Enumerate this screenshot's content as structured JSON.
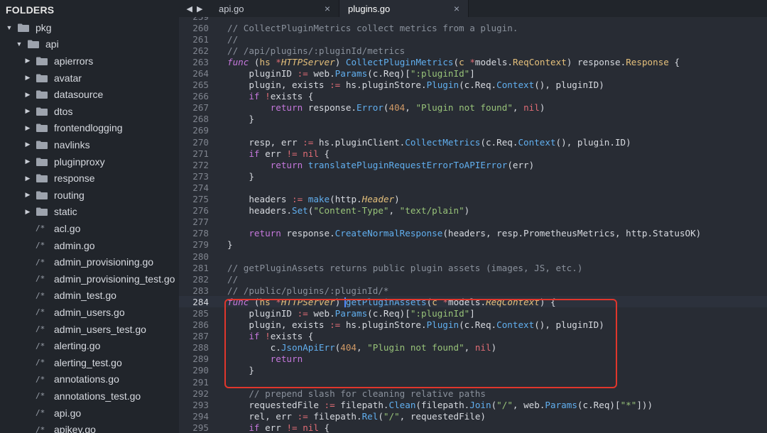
{
  "sidebar": {
    "header": "FOLDERS",
    "tree": [
      {
        "label": "pkg",
        "kind": "folder",
        "open": true,
        "depth": 0
      },
      {
        "label": "api",
        "kind": "folder",
        "open": true,
        "depth": 1
      },
      {
        "label": "apierrors",
        "kind": "folder",
        "open": false,
        "depth": 2
      },
      {
        "label": "avatar",
        "kind": "folder",
        "open": false,
        "depth": 2
      },
      {
        "label": "datasource",
        "kind": "folder",
        "open": false,
        "depth": 2
      },
      {
        "label": "dtos",
        "kind": "folder",
        "open": false,
        "depth": 2
      },
      {
        "label": "frontendlogging",
        "kind": "folder",
        "open": false,
        "depth": 2
      },
      {
        "label": "navlinks",
        "kind": "folder",
        "open": false,
        "depth": 2
      },
      {
        "label": "pluginproxy",
        "kind": "folder",
        "open": false,
        "depth": 2
      },
      {
        "label": "response",
        "kind": "folder",
        "open": false,
        "depth": 2
      },
      {
        "label": "routing",
        "kind": "folder",
        "open": false,
        "depth": 2
      },
      {
        "label": "static",
        "kind": "folder",
        "open": false,
        "depth": 2
      },
      {
        "label": "acl.go",
        "kind": "file",
        "depth": 2
      },
      {
        "label": "admin.go",
        "kind": "file",
        "depth": 2
      },
      {
        "label": "admin_provisioning.go",
        "kind": "file",
        "depth": 2
      },
      {
        "label": "admin_provisioning_test.go",
        "kind": "file",
        "depth": 2
      },
      {
        "label": "admin_test.go",
        "kind": "file",
        "depth": 2
      },
      {
        "label": "admin_users.go",
        "kind": "file",
        "depth": 2
      },
      {
        "label": "admin_users_test.go",
        "kind": "file",
        "depth": 2
      },
      {
        "label": "alerting.go",
        "kind": "file",
        "depth": 2
      },
      {
        "label": "alerting_test.go",
        "kind": "file",
        "depth": 2
      },
      {
        "label": "annotations.go",
        "kind": "file",
        "depth": 2
      },
      {
        "label": "annotations_test.go",
        "kind": "file",
        "depth": 2
      },
      {
        "label": "api.go",
        "kind": "file",
        "depth": 2
      },
      {
        "label": "apikey.go",
        "kind": "file",
        "depth": 2
      }
    ],
    "file_glyph": "/*"
  },
  "tabs": [
    {
      "label": "api.go",
      "active": false,
      "close": "×"
    },
    {
      "label": "plugins.go",
      "active": true,
      "close": "×"
    }
  ],
  "icons": {
    "back": "arrow-left-icon",
    "forward": "arrow-right-icon",
    "folder": "folder-icon",
    "file": "file-icon"
  },
  "colors": {
    "highlight_box": "#e0362c",
    "keyword": "#c678dd",
    "function": "#61afef",
    "type": "#e5c07b",
    "string": "#98c379",
    "number": "#d19a66",
    "comment": "#8a919c"
  },
  "editor": {
    "current_line": 284,
    "lines": [
      {
        "n": "259",
        "tokens": []
      },
      {
        "n": "260",
        "tokens": [
          [
            "cm",
            "// CollectPluginMetrics collect metrics from a plugin."
          ]
        ]
      },
      {
        "n": "261",
        "tokens": [
          [
            "cm",
            "//"
          ]
        ]
      },
      {
        "n": "262",
        "tokens": [
          [
            "cm",
            "// /api/plugins/:pluginId/metrics"
          ]
        ]
      },
      {
        "n": "263",
        "tokens": [
          [
            "kwi",
            "func"
          ],
          [
            "pl",
            " ("
          ],
          [
            "ty",
            "hs"
          ],
          [
            "pl",
            " "
          ],
          [
            "op",
            "*"
          ],
          [
            "tyi",
            "HTTPServer"
          ],
          [
            "pl",
            ") "
          ],
          [
            "fn",
            "CollectPluginMetrics"
          ],
          [
            "pl",
            "("
          ],
          [
            "ty",
            "c"
          ],
          [
            "pl",
            " "
          ],
          [
            "op",
            "*"
          ],
          [
            "pl",
            "models."
          ],
          [
            "ty",
            "ReqContext"
          ],
          [
            "pl",
            ") response."
          ],
          [
            "ty",
            "Response"
          ],
          [
            "pl",
            " {"
          ]
        ]
      },
      {
        "n": "264",
        "tokens": [
          [
            "pl",
            "    pluginID "
          ],
          [
            "op",
            ":="
          ],
          [
            "pl",
            " web."
          ],
          [
            "fn",
            "Params"
          ],
          [
            "pl",
            "(c.Req)["
          ],
          [
            "st",
            "\":pluginId\""
          ],
          [
            "pl",
            "]"
          ]
        ]
      },
      {
        "n": "265",
        "tokens": [
          [
            "pl",
            "    plugin, exists "
          ],
          [
            "op",
            ":="
          ],
          [
            "pl",
            " hs.pluginStore."
          ],
          [
            "fn",
            "Plugin"
          ],
          [
            "pl",
            "(c.Req."
          ],
          [
            "fn",
            "Context"
          ],
          [
            "pl",
            "(), pluginID)"
          ]
        ]
      },
      {
        "n": "266",
        "tokens": [
          [
            "pl",
            "    "
          ],
          [
            "kw",
            "if"
          ],
          [
            "pl",
            " "
          ],
          [
            "op",
            "!"
          ],
          [
            "pl",
            "exists {"
          ]
        ]
      },
      {
        "n": "267",
        "tokens": [
          [
            "pl",
            "        "
          ],
          [
            "kw",
            "return"
          ],
          [
            "pl",
            " response."
          ],
          [
            "fn",
            "Error"
          ],
          [
            "pl",
            "("
          ],
          [
            "nu",
            "404"
          ],
          [
            "pl",
            ", "
          ],
          [
            "st",
            "\"Plugin not found\""
          ],
          [
            "pl",
            ", "
          ],
          [
            "op",
            "nil"
          ],
          [
            "pl",
            ")"
          ]
        ]
      },
      {
        "n": "268",
        "tokens": [
          [
            "pl",
            "    }"
          ]
        ]
      },
      {
        "n": "269",
        "tokens": []
      },
      {
        "n": "270",
        "tokens": [
          [
            "pl",
            "    resp, err "
          ],
          [
            "op",
            ":="
          ],
          [
            "pl",
            " hs.pluginClient."
          ],
          [
            "fn",
            "CollectMetrics"
          ],
          [
            "pl",
            "(c.Req."
          ],
          [
            "fn",
            "Context"
          ],
          [
            "pl",
            "(), plugin.ID)"
          ]
        ]
      },
      {
        "n": "271",
        "tokens": [
          [
            "pl",
            "    "
          ],
          [
            "kw",
            "if"
          ],
          [
            "pl",
            " err "
          ],
          [
            "op",
            "!="
          ],
          [
            "pl",
            " "
          ],
          [
            "op",
            "nil"
          ],
          [
            "pl",
            " {"
          ]
        ]
      },
      {
        "n": "272",
        "tokens": [
          [
            "pl",
            "        "
          ],
          [
            "kw",
            "return"
          ],
          [
            "pl",
            " "
          ],
          [
            "fn",
            "translatePluginRequestErrorToAPIError"
          ],
          [
            "pl",
            "(err)"
          ]
        ]
      },
      {
        "n": "273",
        "tokens": [
          [
            "pl",
            "    }"
          ]
        ]
      },
      {
        "n": "274",
        "tokens": []
      },
      {
        "n": "275",
        "tokens": [
          [
            "pl",
            "    headers "
          ],
          [
            "op",
            ":="
          ],
          [
            "pl",
            " "
          ],
          [
            "fn",
            "make"
          ],
          [
            "pl",
            "(http."
          ],
          [
            "tyi",
            "Header"
          ],
          [
            "pl",
            ")"
          ]
        ]
      },
      {
        "n": "276",
        "tokens": [
          [
            "pl",
            "    headers."
          ],
          [
            "fn",
            "Set"
          ],
          [
            "pl",
            "("
          ],
          [
            "st",
            "\"Content-Type\""
          ],
          [
            "pl",
            ", "
          ],
          [
            "st",
            "\"text/plain\""
          ],
          [
            "pl",
            ")"
          ]
        ]
      },
      {
        "n": "277",
        "tokens": []
      },
      {
        "n": "278",
        "tokens": [
          [
            "pl",
            "    "
          ],
          [
            "kw",
            "return"
          ],
          [
            "pl",
            " response."
          ],
          [
            "fn",
            "CreateNormalResponse"
          ],
          [
            "pl",
            "(headers, resp.PrometheusMetrics, http.StatusOK)"
          ]
        ]
      },
      {
        "n": "279",
        "tokens": [
          [
            "pl",
            "}"
          ]
        ]
      },
      {
        "n": "280",
        "tokens": []
      },
      {
        "n": "281",
        "tokens": [
          [
            "cm",
            "// getPluginAssets returns public plugin assets (images, JS, etc.)"
          ]
        ]
      },
      {
        "n": "282",
        "tokens": [
          [
            "cm",
            "//"
          ]
        ]
      },
      {
        "n": "283",
        "tokens": [
          [
            "cm",
            "// /public/plugins/:pluginId/*"
          ]
        ]
      },
      {
        "n": "284",
        "tokens": [
          [
            "kwi",
            "func"
          ],
          [
            "pl",
            " ("
          ],
          [
            "ty",
            "hs"
          ],
          [
            "pl",
            " "
          ],
          [
            "op",
            "*"
          ],
          [
            "tyi",
            "HTTPServer"
          ],
          [
            "pl",
            ") "
          ],
          [
            "fn",
            "getPluginAssets"
          ],
          [
            "pl",
            "("
          ],
          [
            "ty",
            "c"
          ],
          [
            "pl",
            " "
          ],
          [
            "op",
            "*"
          ],
          [
            "pl",
            "models."
          ],
          [
            "tyi",
            "ReqContext"
          ],
          [
            "pl",
            ") {"
          ]
        ]
      },
      {
        "n": "285",
        "tokens": [
          [
            "pl",
            "    pluginID "
          ],
          [
            "op",
            ":="
          ],
          [
            "pl",
            " web."
          ],
          [
            "fn",
            "Params"
          ],
          [
            "pl",
            "(c.Req)["
          ],
          [
            "st",
            "\":pluginId\""
          ],
          [
            "pl",
            "]"
          ]
        ]
      },
      {
        "n": "286",
        "tokens": [
          [
            "pl",
            "    plugin, exists "
          ],
          [
            "op",
            ":="
          ],
          [
            "pl",
            " hs.pluginStore."
          ],
          [
            "fn",
            "Plugin"
          ],
          [
            "pl",
            "(c.Req."
          ],
          [
            "fn",
            "Context"
          ],
          [
            "pl",
            "(), pluginID)"
          ]
        ]
      },
      {
        "n": "287",
        "tokens": [
          [
            "pl",
            "    "
          ],
          [
            "kw",
            "if"
          ],
          [
            "pl",
            " "
          ],
          [
            "op",
            "!"
          ],
          [
            "pl",
            "exists {"
          ]
        ]
      },
      {
        "n": "288",
        "tokens": [
          [
            "pl",
            "        c."
          ],
          [
            "fn",
            "JsonApiErr"
          ],
          [
            "pl",
            "("
          ],
          [
            "nu",
            "404"
          ],
          [
            "pl",
            ", "
          ],
          [
            "st",
            "\"Plugin not found\""
          ],
          [
            "pl",
            ", "
          ],
          [
            "op",
            "nil"
          ],
          [
            "pl",
            ")"
          ]
        ]
      },
      {
        "n": "289",
        "tokens": [
          [
            "pl",
            "        "
          ],
          [
            "kw",
            "return"
          ]
        ]
      },
      {
        "n": "290",
        "tokens": [
          [
            "pl",
            "    }"
          ]
        ]
      },
      {
        "n": "291",
        "tokens": []
      },
      {
        "n": "292",
        "tokens": [
          [
            "pl",
            "    "
          ],
          [
            "cm",
            "// prepend slash for cleaning relative paths"
          ]
        ]
      },
      {
        "n": "293",
        "tokens": [
          [
            "pl",
            "    requestedFile "
          ],
          [
            "op",
            ":="
          ],
          [
            "pl",
            " filepath."
          ],
          [
            "fn",
            "Clean"
          ],
          [
            "pl",
            "(filepath."
          ],
          [
            "fn",
            "Join"
          ],
          [
            "pl",
            "("
          ],
          [
            "st",
            "\"/\""
          ],
          [
            "pl",
            ", web."
          ],
          [
            "fn",
            "Params"
          ],
          [
            "pl",
            "(c.Req)["
          ],
          [
            "st",
            "\"*\""
          ],
          [
            "pl",
            "]))"
          ]
        ]
      },
      {
        "n": "294",
        "tokens": [
          [
            "pl",
            "    rel, err "
          ],
          [
            "op",
            ":="
          ],
          [
            "pl",
            " filepath."
          ],
          [
            "fn",
            "Rel"
          ],
          [
            "pl",
            "("
          ],
          [
            "st",
            "\"/\""
          ],
          [
            "pl",
            ", requestedFile)"
          ]
        ]
      },
      {
        "n": "295",
        "tokens": [
          [
            "pl",
            "    "
          ],
          [
            "kw",
            "if"
          ],
          [
            "pl",
            " err "
          ],
          [
            "op",
            "!="
          ],
          [
            "pl",
            " "
          ],
          [
            "op",
            "nil"
          ],
          [
            "pl",
            " {"
          ]
        ]
      }
    ]
  }
}
